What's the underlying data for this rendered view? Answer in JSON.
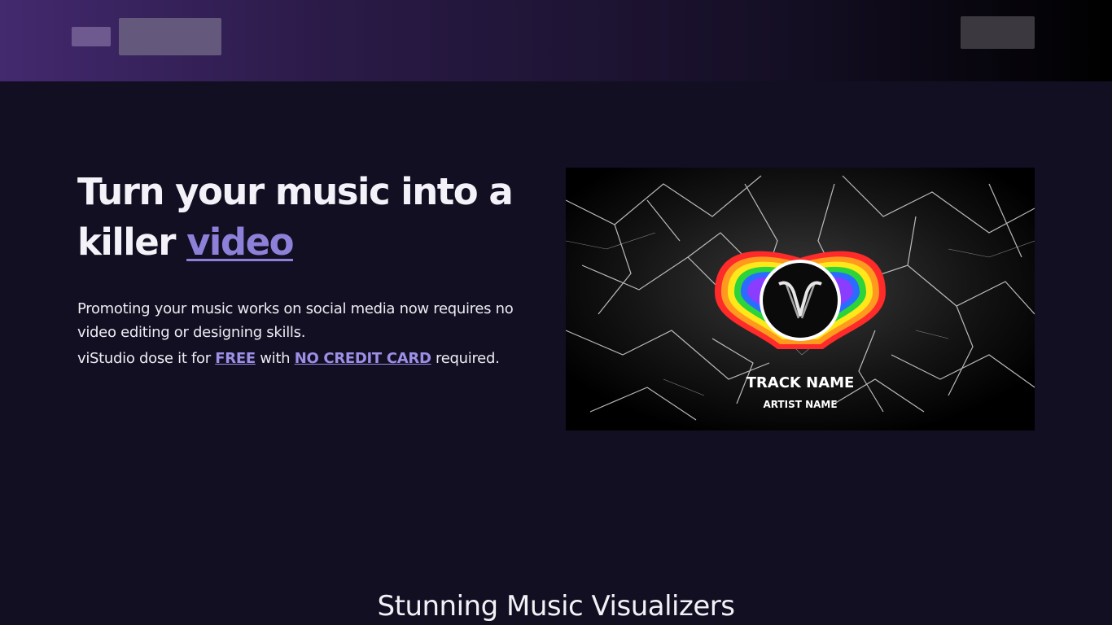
{
  "hero": {
    "title_part1": "Turn your music into a killer ",
    "title_accent": "video",
    "desc": "Promoting your music works on social media now requires no video editing or designing skills.",
    "line3_pre": "viStudio dose it for ",
    "free_link": "FREE",
    "line3_mid": " with ",
    "no_cc_link": "NO CREDIT CARD",
    "line3_post": " required."
  },
  "video_preview": {
    "track_name": "TRACK NAME",
    "artist_name": "ARTIST NAME",
    "logo_icon": "v-logo-icon"
  },
  "section": {
    "title": "Stunning Music Visualizers"
  },
  "colors": {
    "background": "#120f22",
    "accent": "#8d80d9",
    "header_start": "#43296e",
    "header_end": "#000000"
  }
}
